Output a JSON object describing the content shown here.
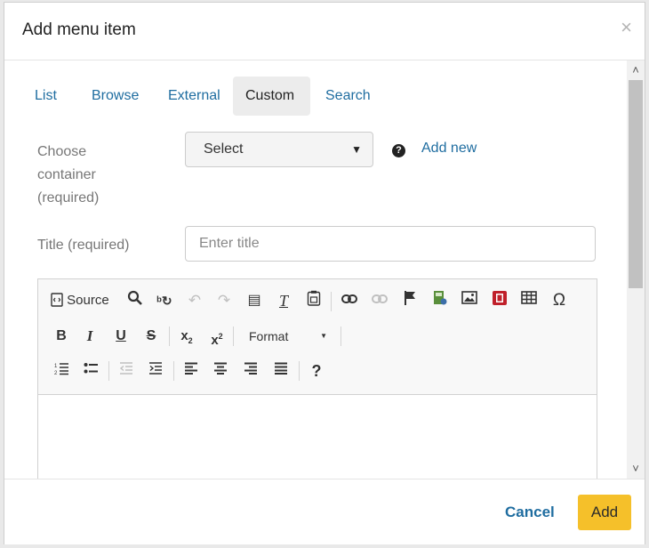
{
  "dialog": {
    "title": "Add menu item",
    "close_symbol": "×"
  },
  "tabs": [
    {
      "label": "List",
      "active": false
    },
    {
      "label": "Browse",
      "active": false
    },
    {
      "label": "External",
      "active": false
    },
    {
      "label": "Custom",
      "active": true
    },
    {
      "label": "Search",
      "active": false
    }
  ],
  "form": {
    "container_label": [
      "Choose",
      "container",
      "(required)"
    ],
    "container_select_value": "Select",
    "add_new_label": "Add new",
    "title_label": "Title (required)",
    "title_placeholder": "Enter title",
    "title_value": ""
  },
  "toolbar": {
    "source_label": "Source",
    "format_label": "Format",
    "icons_row1": [
      "source-icon",
      "find-icon",
      "replace-icon",
      "undo-icon",
      "redo-icon",
      "page-break-icon",
      "remove-format-icon",
      "paste-from-word-icon",
      "link-icon",
      "unlink-icon",
      "anchor-icon",
      "image-gallery-icon",
      "image-icon",
      "video-icon",
      "table-icon",
      "special-char-icon"
    ],
    "icons_row2": [
      "bold-icon",
      "italic-icon",
      "underline-icon",
      "strikethrough-icon",
      "subscript-icon",
      "superscript-icon"
    ],
    "icons_row3": [
      "numbered-list-icon",
      "bulleted-list-icon",
      "outdent-icon",
      "indent-icon",
      "align-left-icon",
      "align-center-icon",
      "align-right-icon",
      "justify-icon",
      "help-icon"
    ]
  },
  "footer": {
    "cancel_label": "Cancel",
    "add_label": "Add"
  },
  "colors": {
    "link": "#1f6da0",
    "primary_button": "#f5c02a",
    "active_tab": "#ececec"
  }
}
